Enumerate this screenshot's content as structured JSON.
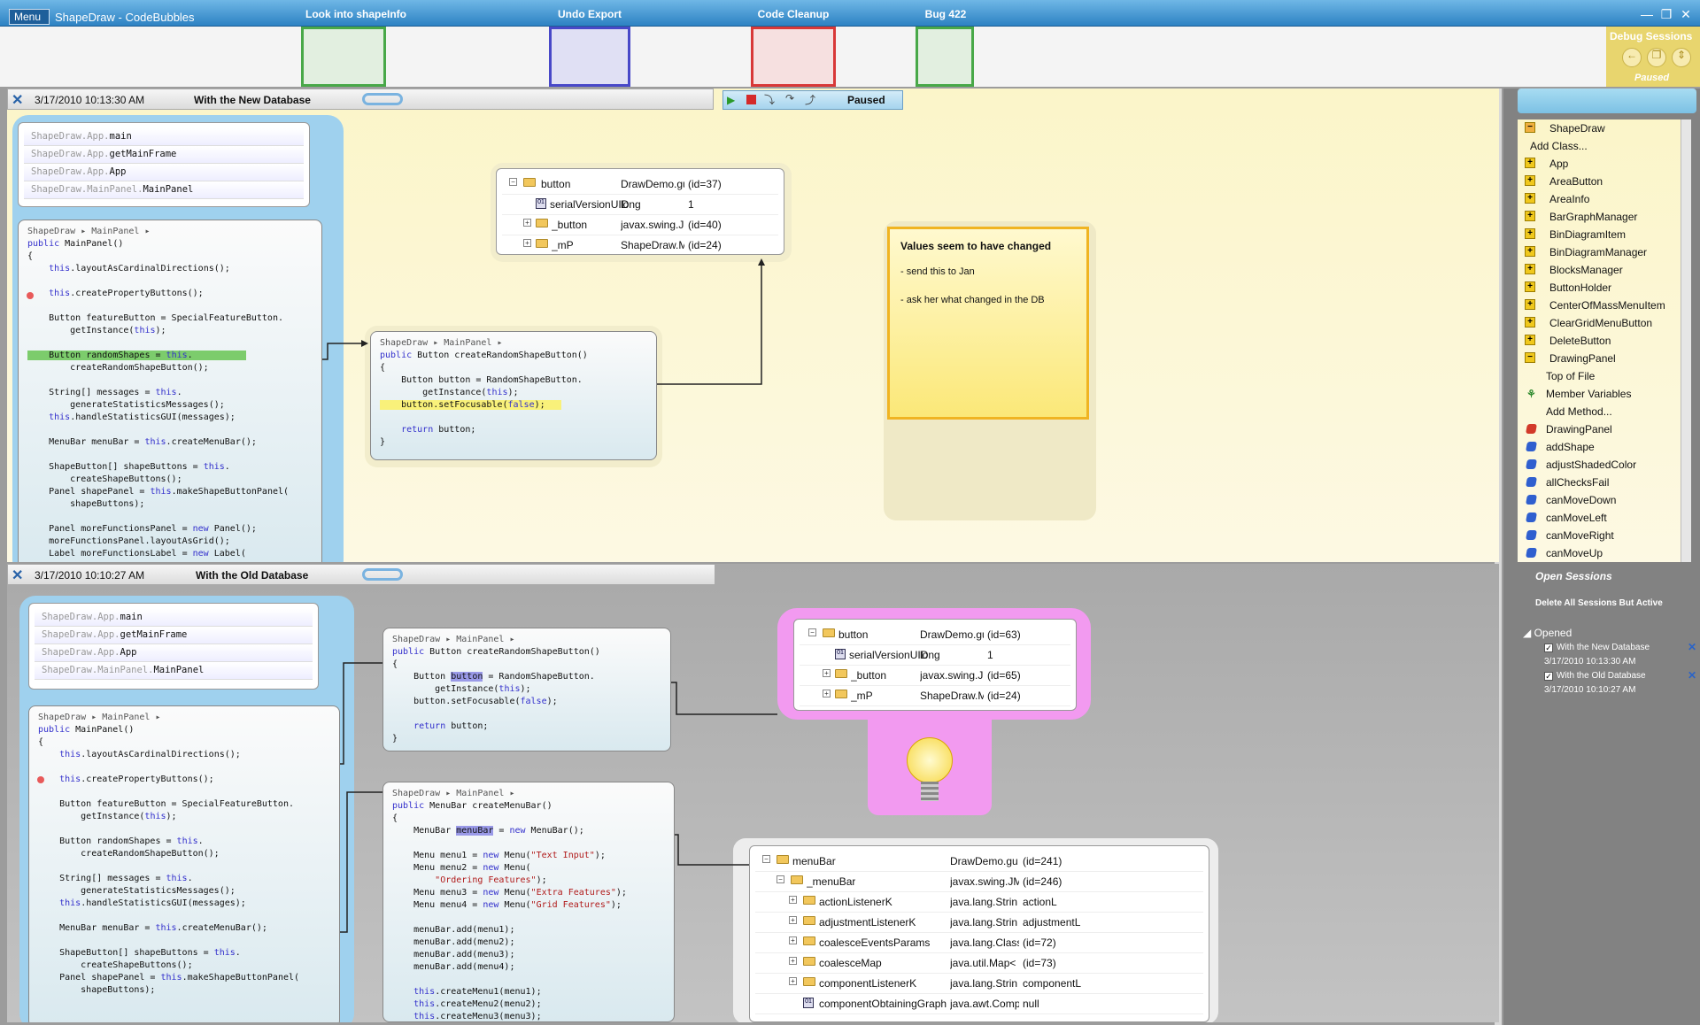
{
  "window": {
    "menu_label": "Menu",
    "title": "ShapeDraw - CodeBubbles"
  },
  "tabs": [
    {
      "label": "Look into shapeInfo",
      "color": "#48a848"
    },
    {
      "label": "Undo Export",
      "color": "#4848c8"
    },
    {
      "label": "Code Cleanup",
      "color": "#d83838"
    },
    {
      "label": "Bug 422",
      "color": "#48a848"
    }
  ],
  "debug": {
    "title": "Debug Sessions",
    "status": "Paused"
  },
  "toolbar": {
    "status": "Paused"
  },
  "ws_top": {
    "date": "3/17/2010 10:13:30 AM",
    "name": "With the New Database",
    "stack": [
      {
        "pkg": "ShapeDraw.App.",
        "m": "main"
      },
      {
        "pkg": "ShapeDraw.App.",
        "m": "getMainFrame"
      },
      {
        "pkg": "ShapeDraw.App.",
        "m": "App"
      },
      {
        "pkg": "ShapeDraw.MainPanel.",
        "m": "MainPanel"
      }
    ],
    "crumb1": "ShapeDraw ▸ MainPanel ▸",
    "crumb2": "ShapeDraw ▸ MainPanel ▸",
    "debug_rows": [
      {
        "name": "button",
        "type": "DrawDemo.gu",
        "val": "(id=37)"
      },
      {
        "name": "serialVersionUID",
        "type": "long",
        "val": "1"
      },
      {
        "name": "_button",
        "type": "javax.swing.JB",
        "val": "(id=40)"
      },
      {
        "name": "_mP",
        "type": "ShapeDraw.M",
        "val": "(id=24)"
      }
    ],
    "note": {
      "title": "Values seem to have changed",
      "line1": "- send this to Jan",
      "line2": "- ask her what changed in the DB"
    }
  },
  "ws_bottom": {
    "date": "3/17/2010 10:10:27 AM",
    "name": "With the Old Database",
    "stack": [
      {
        "pkg": "ShapeDraw.App.",
        "m": "main"
      },
      {
        "pkg": "ShapeDraw.App.",
        "m": "getMainFrame"
      },
      {
        "pkg": "ShapeDraw.App.",
        "m": "App"
      },
      {
        "pkg": "ShapeDraw.MainPanel.",
        "m": "MainPanel"
      }
    ],
    "crumb1": "ShapeDraw ▸ MainPanel ▸",
    "crumb2": "ShapeDraw ▸ MainPanel ▸",
    "crumb3": "ShapeDraw ▸ MainPanel ▸",
    "debug_rows_small": [
      {
        "name": "button",
        "type": "DrawDemo.gu",
        "val": "(id=63)"
      },
      {
        "name": "serialVersionUID",
        "type": "long",
        "val": "1"
      },
      {
        "name": "_button",
        "type": "javax.swing.JB",
        "val": "(id=65)"
      },
      {
        "name": "_mP",
        "type": "ShapeDraw.M",
        "val": "(id=24)"
      }
    ],
    "debug_rows_big": [
      {
        "name": "menuBar",
        "type": "DrawDemo.gu",
        "val": "(id=241)"
      },
      {
        "name": "_menuBar",
        "type": "javax.swing.JM",
        "val": "(id=246)"
      },
      {
        "name": "actionListenerK",
        "type": "java.lang.Strin",
        "val": "actionL"
      },
      {
        "name": "adjustmentListenerK",
        "type": "java.lang.Strin",
        "val": "adjustmentL"
      },
      {
        "name": "coalesceEventsParams",
        "type": "java.lang.Class",
        "val": "(id=72)"
      },
      {
        "name": "coalesceMap",
        "type": "java.util.Map<",
        "val": "(id=73)"
      },
      {
        "name": "componentListenerK",
        "type": "java.lang.Strin",
        "val": "componentL"
      },
      {
        "name": "componentObtainingGraphicsFro",
        "type": "java.awt.Comp",
        "val": "null"
      }
    ]
  },
  "classes": {
    "project": "ShapeDraw",
    "add_class": "Add Class...",
    "items": [
      "App",
      "AreaButton",
      "AreaInfo",
      "BarGraphManager",
      "BinDiagramItem",
      "BinDiagramManager",
      "BlocksManager",
      "ButtonHolder",
      "CenterOfMassMenuItem",
      "ClearGridMenuButton",
      "DeleteButton",
      "DrawingPanel"
    ],
    "sub_items": [
      "Top of File",
      "Member Variables",
      "Add Method..."
    ],
    "methods": [
      "DrawingPanel",
      "addShape",
      "adjustShadedColor",
      "allChecksFail",
      "canMoveDown",
      "canMoveLeft",
      "canMoveRight",
      "canMoveUp"
    ]
  },
  "sessions": {
    "title": "Open Sessions",
    "delete_label": "Delete All Sessions But Active",
    "group": "Opened",
    "list": [
      {
        "name": "With the New Database",
        "date": "3/17/2010 10:13:30 AM"
      },
      {
        "name": "With the Old Database",
        "date": "3/17/2010 10:10:27 AM"
      }
    ]
  }
}
